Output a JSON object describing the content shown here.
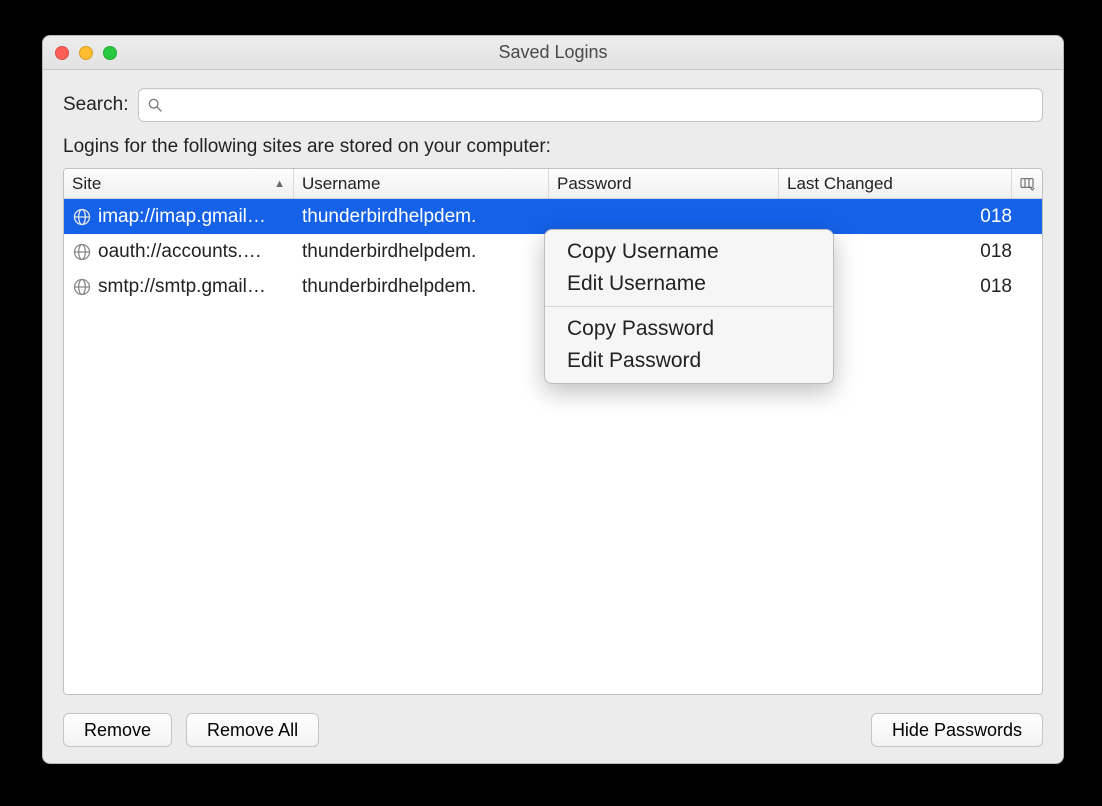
{
  "window": {
    "title": "Saved Logins"
  },
  "search": {
    "label": "Search:",
    "placeholder": ""
  },
  "description": "Logins for the following sites are stored on your computer:",
  "columns": {
    "site": "Site",
    "username": "Username",
    "password": "Password",
    "last_changed": "Last Changed"
  },
  "sort": {
    "column": "site",
    "direction": "asc"
  },
  "rows": [
    {
      "site": "imap://imap.gmail…",
      "username": "thunderbirdhelpdem.",
      "password": "",
      "last_changed_suffix": "018",
      "selected": true
    },
    {
      "site": "oauth://accounts.…",
      "username": "thunderbirdhelpdem.",
      "password": "",
      "last_changed_suffix": "018",
      "selected": false
    },
    {
      "site": "smtp://smtp.gmail…",
      "username": "thunderbirdhelpdem.",
      "password": "",
      "last_changed_suffix": "018",
      "selected": false
    }
  ],
  "context_menu": {
    "copy_username": "Copy Username",
    "edit_username": "Edit Username",
    "copy_password": "Copy Password",
    "edit_password": "Edit Password"
  },
  "buttons": {
    "remove": "Remove",
    "remove_all": "Remove All",
    "hide_passwords": "Hide Passwords"
  }
}
